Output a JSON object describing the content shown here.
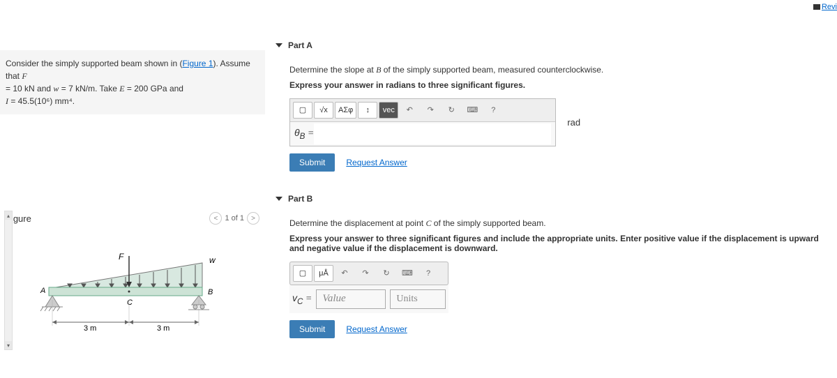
{
  "review_link": "Revi",
  "problem": {
    "line1_pre": "Consider the simply supported beam shown in (",
    "fig_link": "Figure 1",
    "line1_post": "). Assume that ",
    "F": "F",
    "line2": " = 10 kN and ",
    "w": "w",
    "line2b": " = 7 kN/m. Take ",
    "E": "E",
    "line2c": " = 200 GPa and",
    "line3_I": "I",
    "line3": " = 45.5(10⁶) mm⁴."
  },
  "figure": {
    "label": "Figure",
    "page": "1 of 1",
    "F_label": "F",
    "w_label": "w",
    "A": "A",
    "B": "B",
    "C": "C",
    "d1": "3 m",
    "d2": "3 m"
  },
  "partA": {
    "title": "Part A",
    "prompt_pre": "Determine the slope at ",
    "B": "B",
    "prompt_post": " of the simply supported beam, measured counterclockwise.",
    "instruction": "Express your answer in radians to three significant figures.",
    "toolbar": {
      "templates": "▢",
      "sqrt": "√x",
      "greek": "ΑΣφ",
      "subsup": "↕",
      "vec": "vec",
      "undo": "↶",
      "redo": "↷",
      "reset": "↻",
      "keyboard": "⌨",
      "help": "?"
    },
    "var_label": "θ_B =",
    "unit": "rad",
    "submit": "Submit",
    "request": "Request Answer"
  },
  "partB": {
    "title": "Part B",
    "prompt_pre": "Determine the displacement at point ",
    "C": "C",
    "prompt_post": " of the simply supported beam.",
    "instruction": "Express your answer to three significant figures and include the appropriate units. Enter positive value if the displacement is upward and negative value if the displacement is downward.",
    "toolbar": {
      "templates": "▢",
      "units": "μÅ",
      "undo": "↶",
      "redo": "↷",
      "reset": "↻",
      "keyboard": "⌨",
      "help": "?"
    },
    "var_label": "v_C =",
    "value_ph": "Value",
    "units_ph": "Units",
    "submit": "Submit",
    "request": "Request Answer"
  }
}
